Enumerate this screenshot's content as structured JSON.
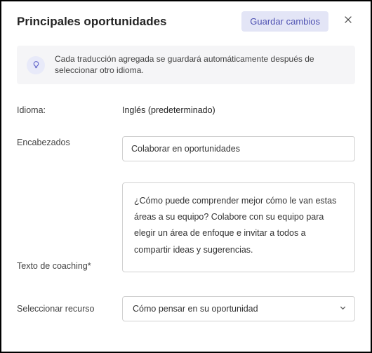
{
  "header": {
    "title": "Principales oportunidades",
    "save_button": "Guardar cambios"
  },
  "banner": {
    "text": "Cada traducción agregada se guardará automáticamente después de seleccionar otro idioma."
  },
  "language": {
    "label": "Idioma:",
    "value": "Inglés (predeterminado)"
  },
  "headings": {
    "label": "Encabezados",
    "value": "Colaborar en oportunidades"
  },
  "coaching": {
    "label": "Texto de coaching*",
    "value": "¿Cómo puede comprender mejor cómo le van estas áreas a su equipo? Colabore con su equipo para elegir un área de enfoque e invitar a todos a compartir ideas y sugerencias."
  },
  "resource": {
    "label": "Seleccionar recurso",
    "selected": "Cómo pensar en su oportunidad"
  }
}
